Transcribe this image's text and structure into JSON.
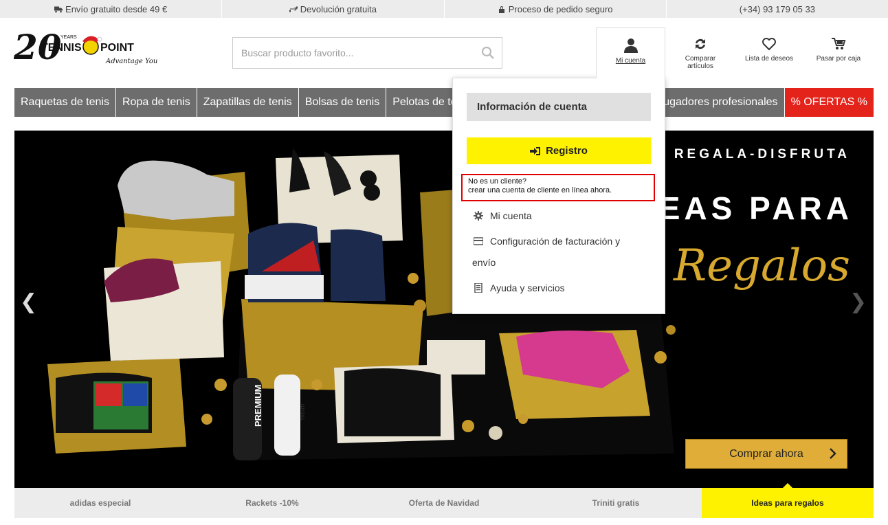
{
  "topbar": {
    "shipping": "Envío gratuito desde 49 €",
    "returns": "Devolución gratuita",
    "secure": "Proceso de pedido seguro",
    "phone": "(+34) 93 179 05 33"
  },
  "logo": {
    "years": "20",
    "years_label": "YEARS",
    "brand_left": "TENNIS",
    "brand_right": "POINT",
    "slogan": "Advantage You"
  },
  "search": {
    "placeholder": "Buscar producto favorito..."
  },
  "header": {
    "account": "Mi cuenta",
    "compare": "Comparar artículos",
    "wishlist": "Lista de deseos",
    "checkout": "Pasar por caja"
  },
  "nav": {
    "items": [
      "Raquetas de tenis",
      "Ropa de tenis",
      "Zapatillas de tenis",
      "Bolsas de tenis",
      "Pelotas de te"
    ],
    "pro": "Jugadores profesionales",
    "offers": "% OFERTAS %"
  },
  "hero": {
    "tagline": "REGALA-DISFRUTA",
    "headline": "EAS PARA",
    "script": "Regalos",
    "cta": "Comprar ahora",
    "product_text": {
      "premium": "PREMIUM",
      "triniti": "TRINITI"
    }
  },
  "tabs": [
    "adidas especial",
    "Rackets -10%",
    "Oferta de Navidad",
    "Triniti gratis",
    "Ideas para regalos"
  ],
  "dropdown": {
    "title": "Información de cuenta",
    "register": "Registro",
    "new_customer_q": "No es un cliente?",
    "new_customer_cta": "crear una cuenta de cliente en línea ahora.",
    "my_account": "Mi cuenta",
    "billing_line1": "Configuración de facturación y",
    "billing_line2": "envío",
    "help": "Ayuda y servicios"
  },
  "colors": {
    "nav_bg": "#6d6d6d",
    "offer_red": "#e4231b",
    "yellow": "#fff200",
    "gold_button": "#e0ae38",
    "highlight_red": "#e00000"
  }
}
